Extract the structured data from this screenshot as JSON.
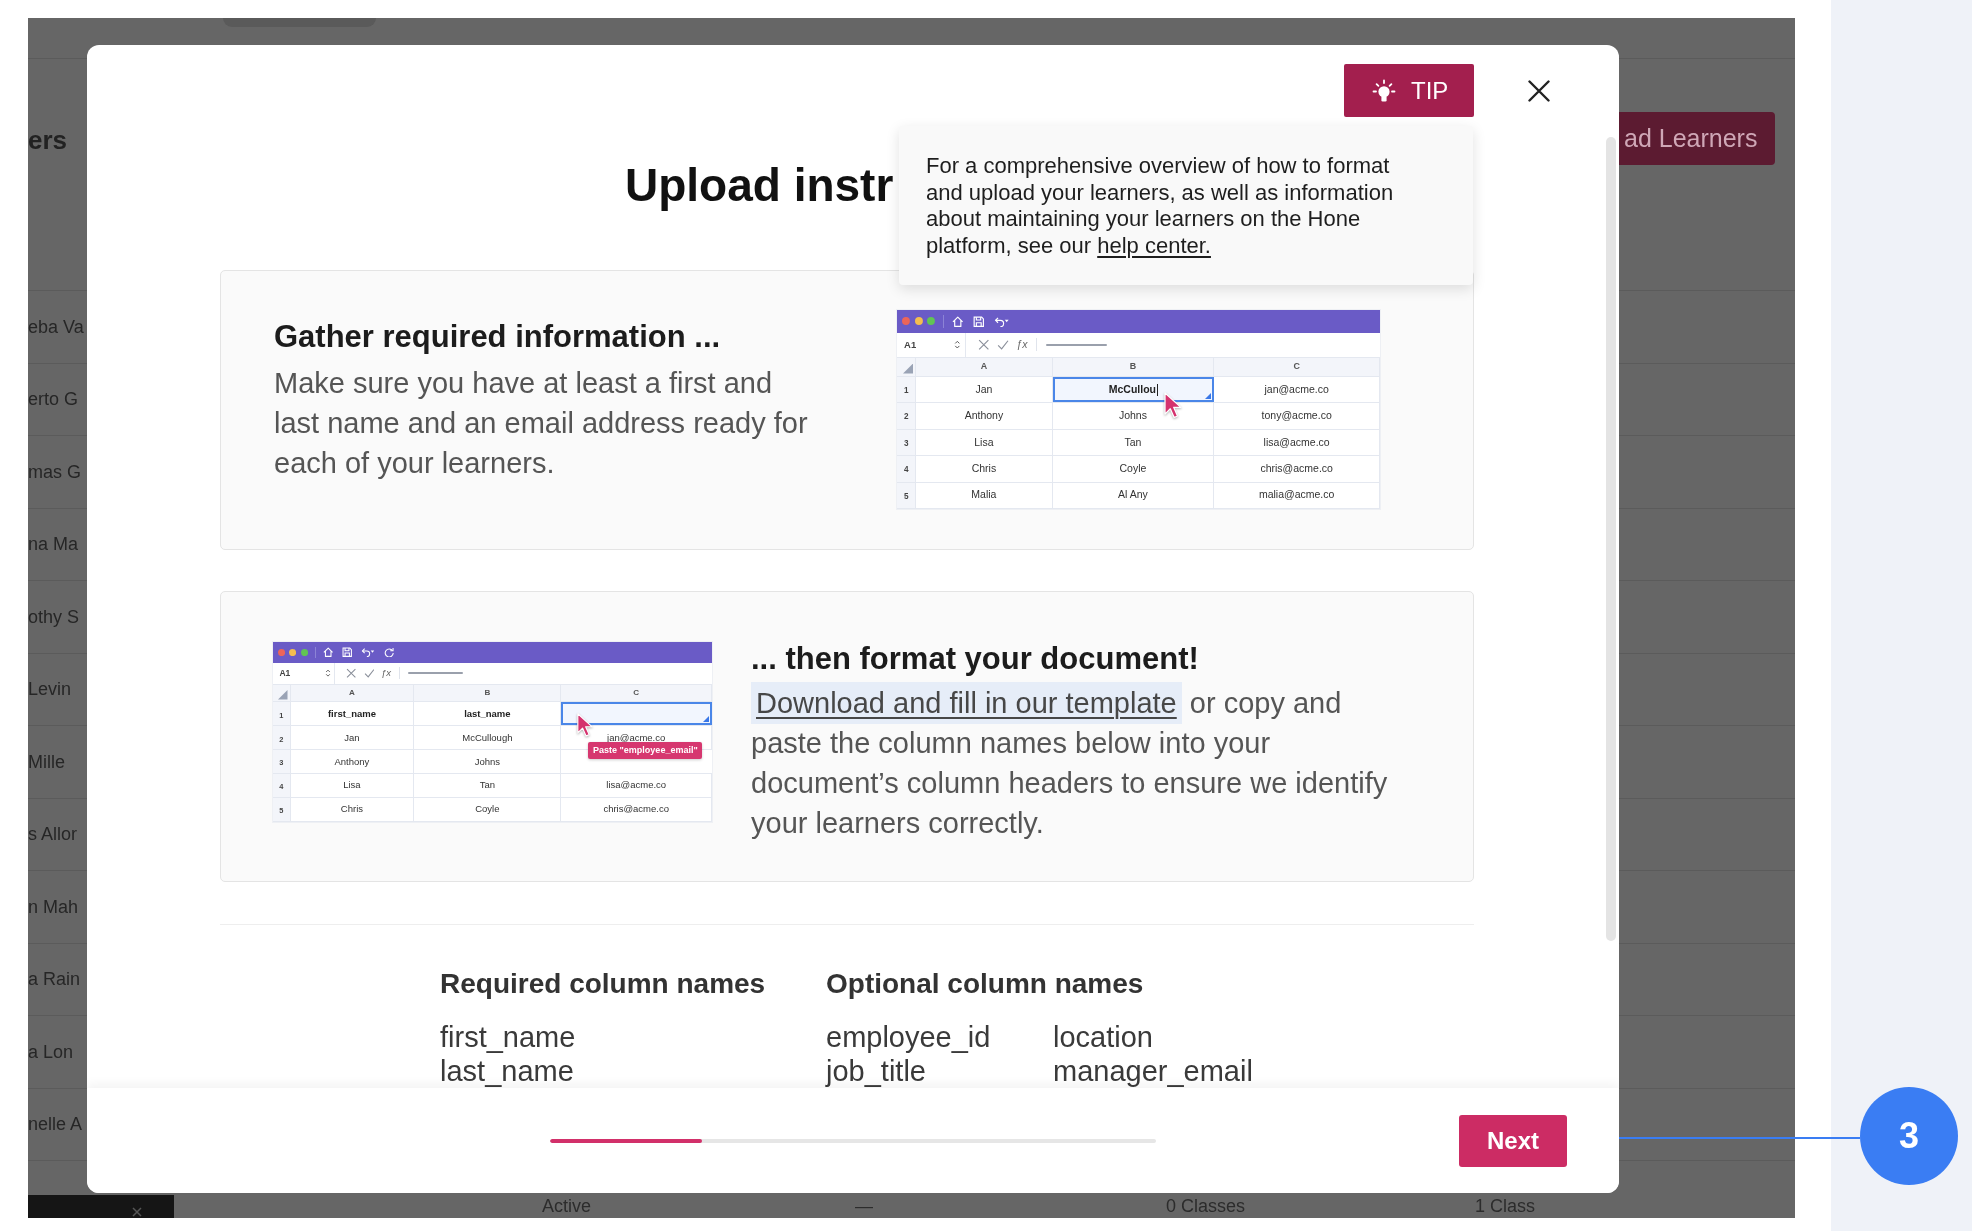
{
  "page": {
    "heading": "ers",
    "rows": [
      "eba Va",
      "erto G",
      "mas G",
      "na Ma",
      "othy S",
      "Levin",
      "Mille",
      "s Allor",
      "n Mah",
      "a Rain",
      "a Lon",
      "nelle A"
    ],
    "action_button": "ad Learners",
    "footer_row": [
      "Active",
      "—",
      "0 Classes",
      "1 Class"
    ]
  },
  "modal": {
    "tip_button": {
      "label": "TIP"
    },
    "title": "Upload instr",
    "tip_popover": {
      "text": "For a comprehensive overview of how to format and upload your learners, as well as information about maintaining your learners on the Hone platform, see our",
      "link": "help center."
    },
    "steps": [
      {
        "kind": "textfirst",
        "heading": "Gather required information ...",
        "body": "Make sure you have at least a first and last name and an email address ready for each of your learners.",
        "spreadsheet": {
          "toolbar": [
            {
              "kind": "home"
            },
            {
              "kind": "save"
            },
            {
              "kind": "undo"
            }
          ],
          "name_box": "A1",
          "function_label": "ƒx",
          "pointer": true,
          "editing": true,
          "columns": [
            "A",
            "B",
            "C"
          ],
          "rows": [
            {
              "kind": "data",
              "number": "1",
              "cells": [
                {
                  "text": "Jan",
                  "selected": false
                },
                {
                  "text": "McCullou",
                  "selected": true
                },
                {
                  "text": "jan@acme.co",
                  "selected": false
                }
              ]
            },
            {
              "kind": "data",
              "number": "2",
              "cells": [
                {
                  "text": "Anthony",
                  "selected": false
                },
                {
                  "text": "Johns",
                  "selected": false
                },
                {
                  "text": "tony@acme.co",
                  "selected": false
                }
              ]
            },
            {
              "kind": "data",
              "number": "3",
              "cells": [
                {
                  "text": "Lisa",
                  "selected": false
                },
                {
                  "text": "Tan",
                  "selected": false
                },
                {
                  "text": "lisa@acme.co",
                  "selected": false
                }
              ]
            },
            {
              "kind": "data",
              "number": "4",
              "cells": [
                {
                  "text": "Chris",
                  "selected": false
                },
                {
                  "text": "Coyle",
                  "selected": false
                },
                {
                  "text": "chris@acme.co",
                  "selected": false
                }
              ]
            },
            {
              "kind": "data",
              "number": "5",
              "cells": [
                {
                  "text": "Malia",
                  "selected": false
                },
                {
                  "text": "Al Any",
                  "selected": false
                },
                {
                  "text": "malia@acme.co",
                  "selected": false
                }
              ]
            }
          ]
        }
      },
      {
        "kind": "imagefirst",
        "heading": "... then format your document!",
        "link": "Download and fill in our template",
        "body": "or copy and paste the column names below into your document’s column headers to ensure we identify your learners correctly.",
        "spreadsheet": {
          "toolbar": [
            {
              "kind": "home"
            },
            {
              "kind": "save"
            },
            {
              "kind": "undo"
            },
            {
              "kind": "refresh"
            }
          ],
          "name_box": "A1",
          "function_label": "ƒx",
          "pointer": true,
          "editing": false,
          "tooltip": "Paste \"employee_email\"",
          "columns": [
            "A",
            "B",
            "C"
          ],
          "rows": [
            {
              "kind": "header",
              "number": "1",
              "cells": [
                {
                  "text": "first_name",
                  "selected": false
                },
                {
                  "text": "last_name",
                  "selected": false
                },
                {
                  "selected": true
                }
              ]
            },
            {
              "kind": "data",
              "number": "2",
              "cells": [
                {
                  "text": "Jan",
                  "selected": false
                },
                {
                  "text": "McCullough",
                  "selected": false
                },
                {
                  "text": "jan@acme.co",
                  "selected": false
                }
              ]
            },
            {
              "kind": "data",
              "number": "3",
              "cells": [
                {
                  "text": "Anthony",
                  "selected": false
                },
                {
                  "text": "Johns",
                  "selected": false
                }
              ]
            },
            {
              "kind": "data",
              "number": "4",
              "cells": [
                {
                  "text": "Lisa",
                  "selected": false
                },
                {
                  "text": "Tan",
                  "selected": false
                },
                {
                  "text": "lisa@acme.co",
                  "selected": false
                }
              ]
            },
            {
              "kind": "data",
              "number": "5",
              "cells": [
                {
                  "text": "Chris",
                  "selected": false
                },
                {
                  "text": "Coyle",
                  "selected": false
                },
                {
                  "text": "chris@acme.co",
                  "selected": false
                }
              ]
            }
          ]
        }
      }
    ],
    "column_names": {
      "required": {
        "heading": "Required column names",
        "items": [
          "first_name",
          "last_name"
        ]
      },
      "optional": {
        "heading": "Optional column names",
        "items": [
          "employee_id",
          "location",
          "job_title",
          "manager_email"
        ]
      }
    },
    "progress": {
      "level": 0.25
    },
    "next_button": {
      "label": "Next"
    }
  },
  "callout": {
    "number": "3"
  }
}
